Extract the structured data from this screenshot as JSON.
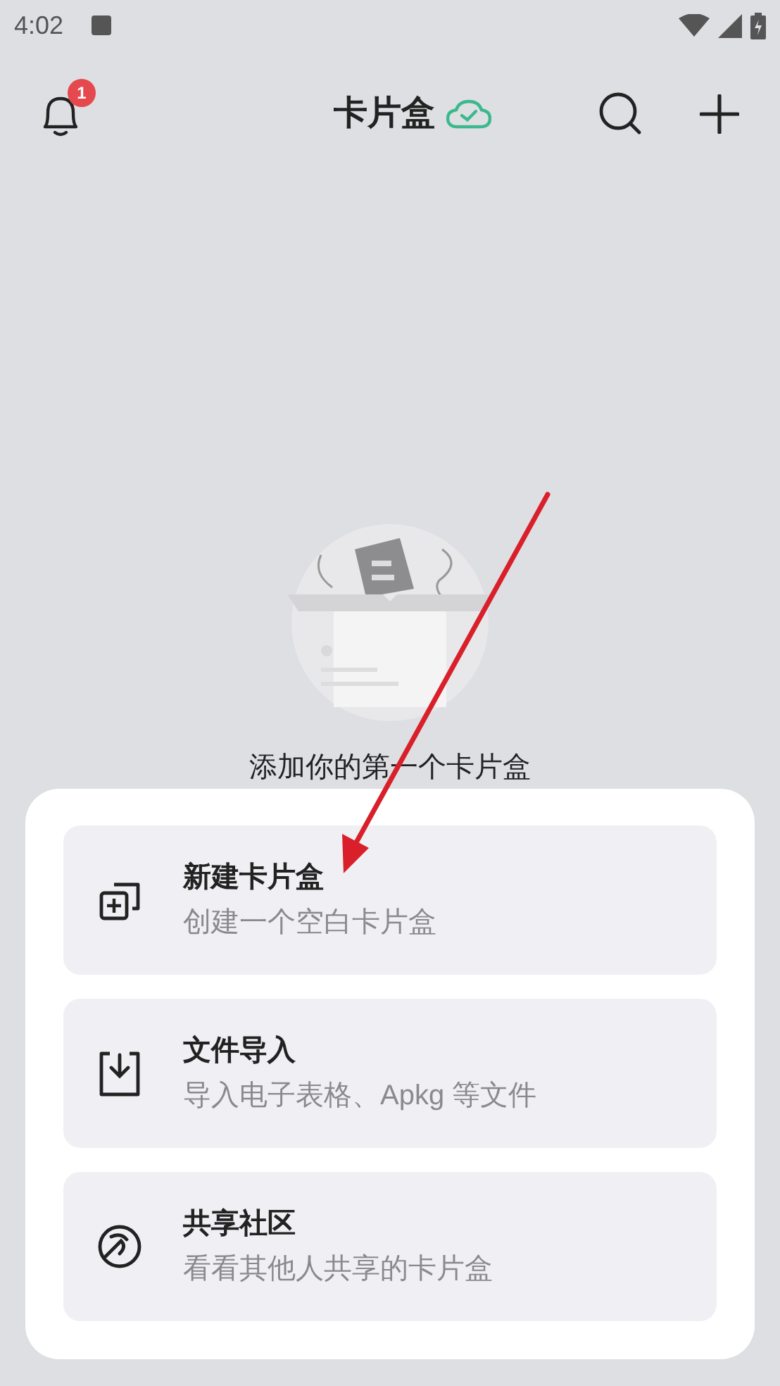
{
  "status_bar": {
    "time": "4:02"
  },
  "header": {
    "title": "卡片盒",
    "notification_count": "1",
    "synced": true
  },
  "empty_state": {
    "message": "添加你的第一个卡片盒"
  },
  "sheet": {
    "options": [
      {
        "kind": "new",
        "title": "新建卡片盒",
        "subtitle": "创建一个空白卡片盒"
      },
      {
        "kind": "import",
        "title": "文件导入",
        "subtitle": "导入电子表格、Apkg 等文件"
      },
      {
        "kind": "community",
        "title": "共享社区",
        "subtitle": "看看其他人共享的卡片盒"
      }
    ]
  }
}
